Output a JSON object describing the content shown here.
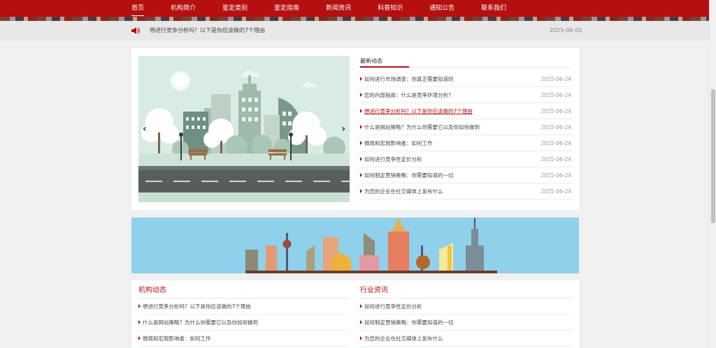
{
  "nav": {
    "items": [
      {
        "label": "首页",
        "active": true
      },
      {
        "label": "机构简介"
      },
      {
        "label": "鉴定类别"
      },
      {
        "label": "鉴定指南"
      },
      {
        "label": "新闻资讯"
      },
      {
        "label": "科普知识"
      },
      {
        "label": "通知公告"
      },
      {
        "label": "联系我们"
      }
    ]
  },
  "notice": {
    "icon": "speaker-icon",
    "text": "想进行竞争分析吗？以下是你应该做的7个理由",
    "date": "2025-06-05"
  },
  "slider": {
    "prev_label": "‹",
    "next_label": "›"
  },
  "latest": {
    "title": "最新动态",
    "items": [
      {
        "title": "如何进行市场调查：你真正需要知道的",
        "date": "2025-06-24"
      },
      {
        "title": "您的内部指南：什么是竞争环境分析?",
        "date": "2025-06-24"
      },
      {
        "title": "想进行竞争分析吗？以下是你应该做的7个理由",
        "date": "2025-06-24",
        "highlight": true
      },
      {
        "title": "什么是网站策略？为什么你需要它以及你如何做到",
        "date": "2025-06-24"
      },
      {
        "title": "微观和宏观影响者：如何工作",
        "date": "2025-06-24"
      },
      {
        "title": "如何进行竞争性定价分析",
        "date": "2025-06-24"
      },
      {
        "title": "如何制定营销策略：你需要知道的一切",
        "date": "2025-06-24"
      },
      {
        "title": "为您的企业在社交媒体上发布什么",
        "date": "2025-06-24"
      }
    ]
  },
  "org_news": {
    "title": "机构动态",
    "items": [
      {
        "title": "想进行竞争分析吗？以下是你应该做的7个理由"
      },
      {
        "title": "什么是网站策略？为什么你需要它以及你如何做到"
      },
      {
        "title": "微观和宏观影响者：如何工作"
      }
    ]
  },
  "industry_news": {
    "title": "行业资讯",
    "items": [
      {
        "title": "如何进行竞争性定价分析"
      },
      {
        "title": "如何制定营销策略：你需要知道的一切"
      },
      {
        "title": "为您的企业在社交媒体上发布什么"
      }
    ]
  },
  "colors": {
    "brand_red": "#b50f0f",
    "banner_sky": "#8fd0ea"
  }
}
